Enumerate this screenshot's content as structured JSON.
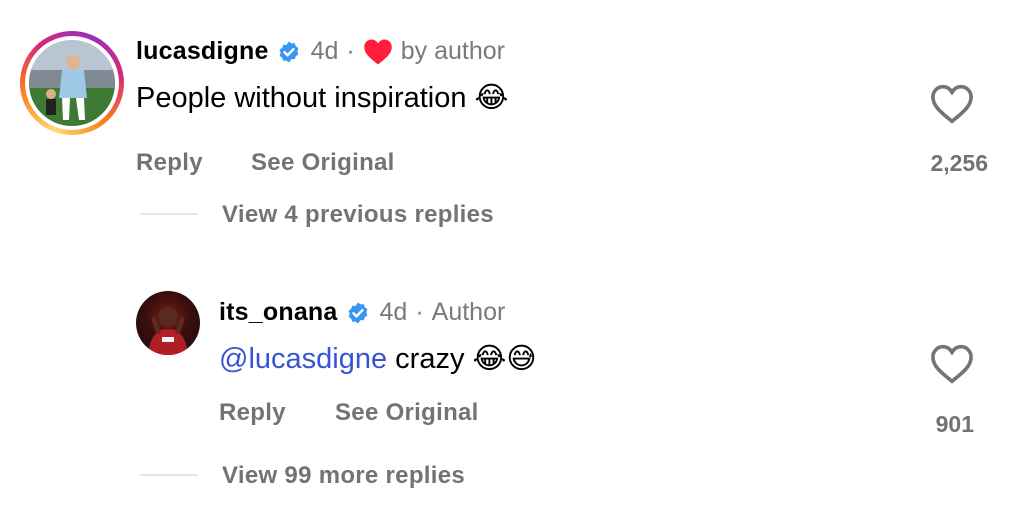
{
  "comments": [
    {
      "username": "lucasdigne",
      "time": "4d",
      "liked_by_author_label": "by author",
      "text": "People without inspiration",
      "emoji": "😂",
      "reply_label": "Reply",
      "see_original_label": "See Original",
      "like_count": "2,256",
      "view_replies_label": "View 4 previous replies"
    },
    {
      "username": "its_onana",
      "time": "4d",
      "author_label": "Author",
      "mention": "@lucasdigne",
      "text": "crazy",
      "emoji": "😂😅",
      "reply_label": "Reply",
      "see_original_label": "See Original",
      "like_count": "901",
      "view_replies_label": "View 99 more replies"
    }
  ],
  "colors": {
    "verified_blue": "#3897f0",
    "heart_red": "#ff1f3d",
    "mention_blue": "#3853d6",
    "muted_gray": "#737373"
  },
  "icons": {
    "verified": "verified-badge-icon",
    "liked": "heart-filled-icon",
    "like": "heart-outline-icon"
  }
}
